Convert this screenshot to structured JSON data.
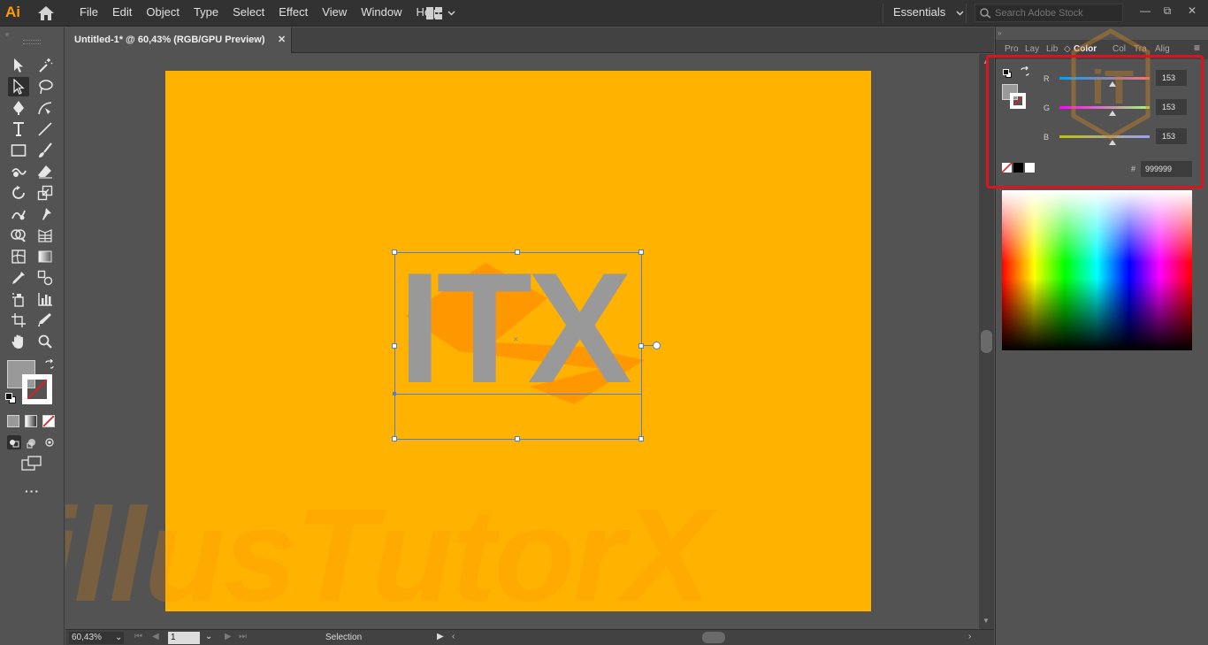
{
  "app": {
    "logo": "Ai",
    "menu": [
      "File",
      "Edit",
      "Object",
      "Type",
      "Select",
      "Effect",
      "View",
      "Window",
      "Help"
    ],
    "workspace": "Essentials",
    "search_placeholder": "Search Adobe Stock",
    "window_buttons": [
      "—",
      "⧉",
      "✕"
    ]
  },
  "document": {
    "tab_title": "Untitled-1* @ 60,43% (RGB/GPU Preview)",
    "close_glyph": "✕",
    "artboard_color": "#ffb300",
    "text_object": "ITX",
    "text_color": "#999999",
    "watermark": "illusTutorX"
  },
  "status": {
    "zoom": "60,43%",
    "artboard_number": "1",
    "tool_name": "Selection"
  },
  "panel": {
    "tabs": [
      "Pro",
      "Lay",
      "Lib",
      "Color",
      "Col",
      "Tra",
      "Alig"
    ],
    "active_tab": "Color",
    "channels": [
      {
        "label": "R",
        "value": "153"
      },
      {
        "label": "G",
        "value": "153"
      },
      {
        "label": "B",
        "value": "153"
      }
    ],
    "hex_label": "#",
    "hex_value": "999999",
    "highlight_color": "#e0121c"
  },
  "icons": {
    "toolbar": [
      "selection-tool-icon",
      "magic-wand-icon",
      "direct-selection-icon",
      "lasso-icon",
      "pen-icon",
      "curvature-icon",
      "type-icon",
      "line-icon",
      "rectangle-icon",
      "paintbrush-icon",
      "shaper-icon",
      "eraser-icon",
      "rotate-icon",
      "scale-icon",
      "warp-icon",
      "puppet-warp-icon",
      "shape-builder-icon",
      "perspective-grid-icon",
      "mesh-icon",
      "gradient-icon",
      "eyedropper-icon",
      "blend-icon",
      "symbol-sprayer-icon",
      "column-graph-icon",
      "artboard-icon",
      "slice-icon",
      "hand-icon",
      "zoom-icon"
    ]
  }
}
